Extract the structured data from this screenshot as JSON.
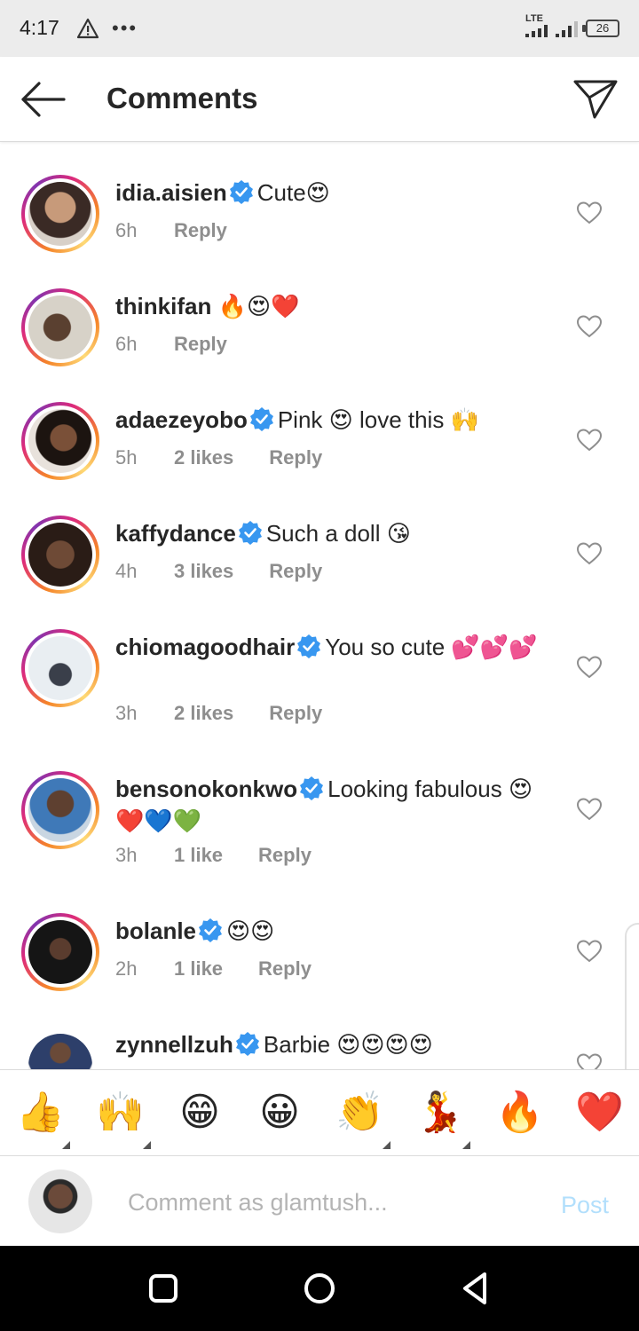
{
  "status_bar": {
    "time": "4:17",
    "network": "LTE",
    "battery": "26"
  },
  "header": {
    "title": "Comments"
  },
  "comments": [
    {
      "username": "idia.aisien",
      "verified": true,
      "text": "Cute😍",
      "time": "6h",
      "likes": "",
      "reply": "Reply"
    },
    {
      "username": "thinkifan",
      "verified": false,
      "text": "🔥😍❤️",
      "time": "6h",
      "likes": "",
      "reply": "Reply"
    },
    {
      "username": "adaezeyobo",
      "verified": true,
      "text": "Pink 😍 love this 🙌",
      "time": "5h",
      "likes": "2 likes",
      "reply": "Reply"
    },
    {
      "username": "kaffydance",
      "verified": true,
      "text": "Such a doll 😘",
      "time": "4h",
      "likes": "3 likes",
      "reply": "Reply"
    },
    {
      "username": "chiomagoodhair",
      "verified": true,
      "text": "You so cute 💕💕💕",
      "time": "3h",
      "likes": "2 likes",
      "reply": "Reply"
    },
    {
      "username": "bensonokonkwo",
      "verified": true,
      "text": "Looking fabulous 😍❤️💙💚",
      "time": "3h",
      "likes": "1 like",
      "reply": "Reply"
    },
    {
      "username": "bolanle",
      "verified": true,
      "text": "😍😍",
      "time": "2h",
      "likes": "1 like",
      "reply": "Reply"
    },
    {
      "username": "zynnellzuh",
      "verified": true,
      "text": "Barbie 😍😍😍😍",
      "time": "",
      "likes": "",
      "reply": ""
    }
  ],
  "quick_emojis": [
    "👍",
    "🙌",
    "😁",
    "😀",
    "👏",
    "💃",
    "🔥",
    "❤️"
  ],
  "comment_bar": {
    "placeholder": "Comment as glamtush...",
    "post_label": "Post"
  },
  "colors": {
    "accent": "#3897f0",
    "post_disabled": "#b2dffc",
    "meta": "#8e8e8e",
    "heart_red": "#ed4956"
  }
}
